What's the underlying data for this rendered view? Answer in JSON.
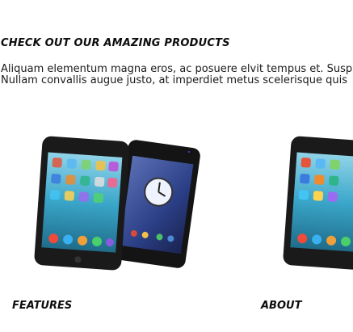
{
  "section": {
    "heading": "CHECK OUT OUR AMAZING PRODUCTS",
    "intro_lines": [
      "Aliquam elementum magna eros, ac posuere elvit tempus et. Susp",
      "Nullam convallis augue justo, at imperdiet metus scelerisque quis"
    ]
  },
  "products": [
    {
      "title": "FEATURES",
      "image": "smartphones-photo"
    },
    {
      "title": "ABOUT",
      "image": "smartphones-photo"
    }
  ],
  "colors": {
    "text": "#111111",
    "background": "#ffffff"
  }
}
